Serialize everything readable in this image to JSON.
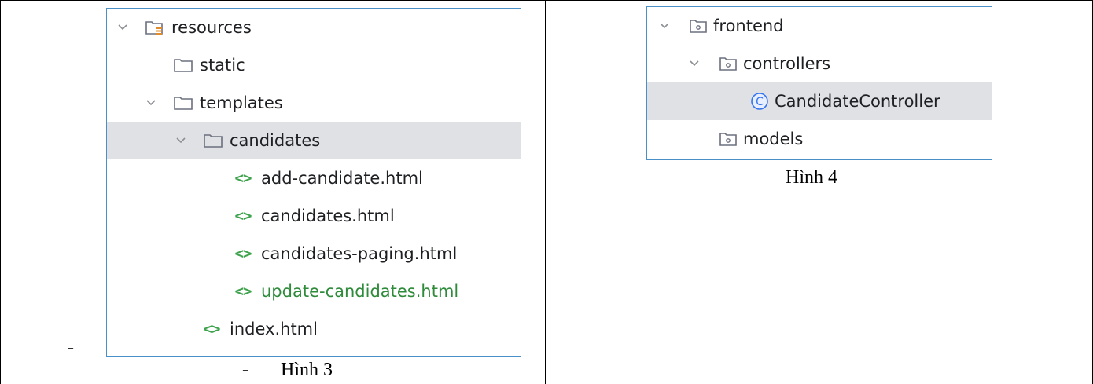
{
  "figure3": {
    "caption_dash": "-",
    "caption": "Hình 3",
    "stray_dash": "-",
    "tree": [
      {
        "label": "resources",
        "chevron": "expanded",
        "icon": "resources-folder-icon"
      },
      {
        "label": "static",
        "icon": "folder-icon"
      },
      {
        "label": "templates",
        "chevron": "expanded",
        "icon": "folder-icon"
      },
      {
        "label": "candidates",
        "chevron": "expanded",
        "icon": "folder-icon",
        "selected": true
      },
      {
        "label": "add-candidate.html",
        "icon": "html-file-icon",
        "icon_text": "<>"
      },
      {
        "label": "candidates.html",
        "icon": "html-file-icon",
        "icon_text": "<>"
      },
      {
        "label": "candidates-paging.html",
        "icon": "html-file-icon",
        "icon_text": "<>"
      },
      {
        "label": "update-candidates.html",
        "icon": "html-file-icon",
        "icon_text": "<>",
        "color": "#2e8b3a"
      },
      {
        "label": "index.html",
        "icon": "html-file-icon",
        "icon_text": "<>"
      }
    ]
  },
  "figure4": {
    "caption": "Hình 4",
    "tree": [
      {
        "label": "frontend",
        "chevron": "expanded",
        "icon": "package-icon"
      },
      {
        "label": "controllers",
        "chevron": "expanded",
        "icon": "package-icon"
      },
      {
        "label": "CandidateController",
        "icon": "class-icon",
        "icon_text": "C",
        "selected": true
      },
      {
        "label": "models",
        "icon": "package-icon"
      }
    ]
  },
  "colors": {
    "selection": "#dfe1e5",
    "border_blue": "#4a90c8",
    "html_icon_green": "#3fa34d",
    "vcs_added_green": "#2e8b3a",
    "class_icon_blue": "#3574f0"
  }
}
